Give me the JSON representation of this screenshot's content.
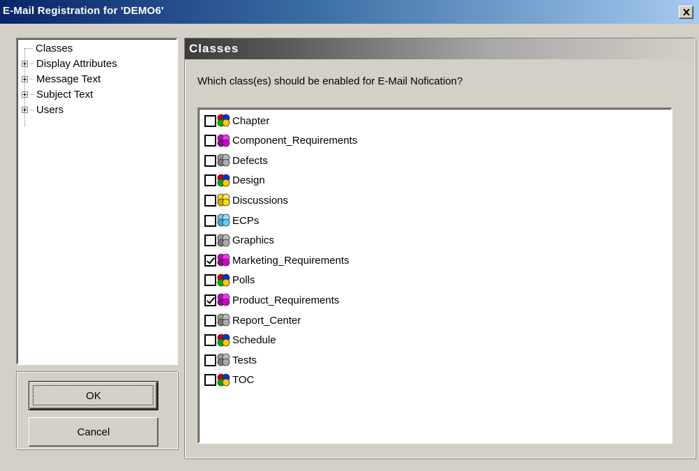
{
  "window": {
    "title": "E-Mail Registration for 'DEMO6'",
    "close_glyph": "✕"
  },
  "tree": {
    "items": [
      {
        "label": "Classes",
        "expandable": false
      },
      {
        "label": "Display Attributes",
        "expandable": true
      },
      {
        "label": "Message Text",
        "expandable": true
      },
      {
        "label": "Subject Text",
        "expandable": true
      },
      {
        "label": "Users",
        "expandable": true
      }
    ]
  },
  "buttons": {
    "ok": "OK",
    "cancel": "Cancel"
  },
  "panel": {
    "header": "Classes",
    "question": "Which class(es) should be enabled for E-Mail Nofication?"
  },
  "classes": [
    {
      "label": "Chapter",
      "checked": false,
      "icon": "multicolor-cluster-icon",
      "colors": [
        "#cc0000",
        "#0033cc",
        "#00aa00",
        "#ffcc00"
      ]
    },
    {
      "label": "Component_Requirements",
      "checked": false,
      "icon": "magenta-cluster-icon",
      "colors": [
        "#cc00cc",
        "#ff33ff",
        "#990099",
        "#cc00cc"
      ]
    },
    {
      "label": "Defects",
      "checked": false,
      "icon": "gray-cluster-icon",
      "colors": [
        "#999999",
        "#bbbbbb",
        "#777777",
        "#aaaaaa"
      ]
    },
    {
      "label": "Design",
      "checked": false,
      "icon": "multicolor-cluster-icon",
      "colors": [
        "#cc0000",
        "#0033cc",
        "#00aa00",
        "#ffcc00"
      ]
    },
    {
      "label": "Discussions",
      "checked": false,
      "icon": "yellow-cluster-icon",
      "colors": [
        "#ffdd00",
        "#ffee55",
        "#ccaa00",
        "#ffdd00"
      ]
    },
    {
      "label": "ECPs",
      "checked": false,
      "icon": "cyan-cluster-icon",
      "colors": [
        "#66ccff",
        "#99ddff",
        "#33aadd",
        "#66ccff"
      ]
    },
    {
      "label": "Graphics",
      "checked": false,
      "icon": "gray-cluster-icon",
      "colors": [
        "#999999",
        "#bbbbbb",
        "#777777",
        "#aaaaaa"
      ]
    },
    {
      "label": "Marketing_Requirements",
      "checked": true,
      "icon": "magenta-cluster-icon",
      "colors": [
        "#cc00cc",
        "#ff33ff",
        "#990099",
        "#cc00cc"
      ]
    },
    {
      "label": "Polls",
      "checked": false,
      "icon": "multicolor-cluster-icon",
      "colors": [
        "#cc0000",
        "#0033cc",
        "#00aa00",
        "#ffcc00"
      ]
    },
    {
      "label": "Product_Requirements",
      "checked": true,
      "icon": "magenta-cluster-icon",
      "colors": [
        "#cc00cc",
        "#ff33ff",
        "#990099",
        "#cc00cc"
      ]
    },
    {
      "label": "Report_Center",
      "checked": false,
      "icon": "gray-cluster-icon",
      "colors": [
        "#999999",
        "#bbbbbb",
        "#777777",
        "#aaaaaa"
      ]
    },
    {
      "label": "Schedule",
      "checked": false,
      "icon": "multicolor-cluster-icon",
      "colors": [
        "#cc0000",
        "#0033cc",
        "#00aa00",
        "#ffcc00"
      ]
    },
    {
      "label": "Tests",
      "checked": false,
      "icon": "gray-cluster-icon",
      "colors": [
        "#999999",
        "#bbbbbb",
        "#777777",
        "#aaaaaa"
      ]
    },
    {
      "label": "TOC",
      "checked": false,
      "icon": "multicolor-cluster-icon",
      "colors": [
        "#cc0000",
        "#0033cc",
        "#00aa00",
        "#ffcc00"
      ]
    }
  ]
}
